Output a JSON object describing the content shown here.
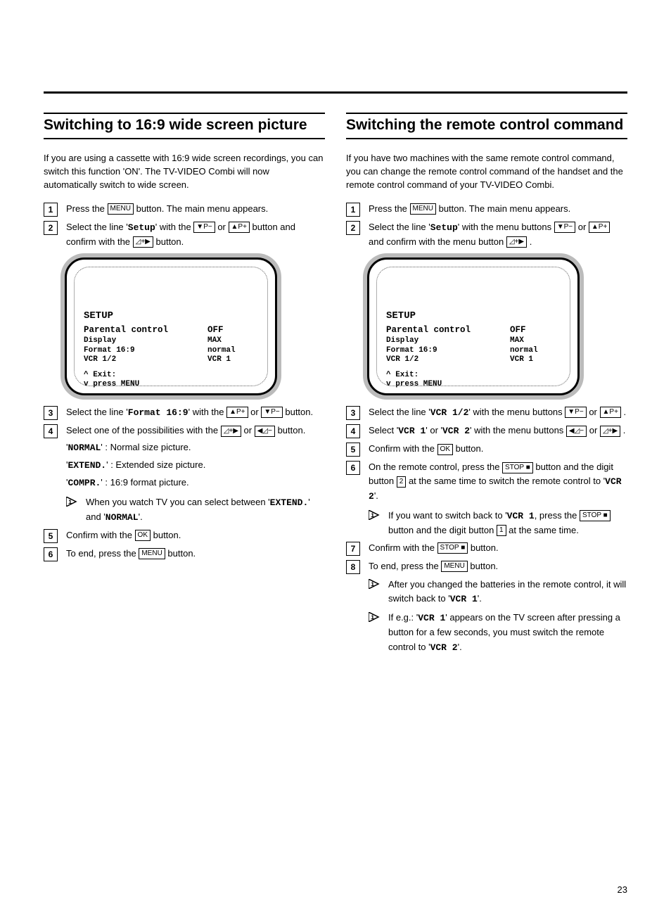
{
  "page_number": "23",
  "left": {
    "title": "Switching to 16:9 wide screen picture",
    "intro": "If you are using a cassette with 16:9 wide screen recordings, you can switch this function 'ON'. The TV-VIDEO Combi will now automatically switch to wide screen.",
    "steps": {
      "s1_a": "Press the ",
      "s1_btn": "MENU",
      "s1_b": " button. The main menu appears.",
      "s2_a": "Select the line '",
      "s2_code": "Setup",
      "s2_b": "' with the ",
      "s2_btn1": "▼P−",
      "s2_c": " or ",
      "s2_btn2": "▲P+",
      "s2_d": " button and confirm with the ",
      "s2_btn3": "◿+▶",
      "s2_e": " button.",
      "s3_a": "Select the line '",
      "s3_code": "Format 16:9",
      "s3_b": "' with the ",
      "s3_btn1": "▲P+",
      "s3_c": " or ",
      "s3_btn2": "▼P−",
      "s3_d": " button.",
      "s4_a": "Select one of the possibilities with the ",
      "s4_btn1": "◿+▶",
      "s4_b": " or ",
      "s4_btn2": "◀◿−",
      "s4_c": " button.",
      "s4_opt1_code": "NORMAL",
      "s4_opt1_txt": " : Normal size picture.",
      "s4_opt2_code": "EXTEND.",
      "s4_opt2_txt": " : Extended size picture.",
      "s4_opt3_code": "COMPR.",
      "s4_opt3_txt": " : 16:9 format picture.",
      "s4_note_a": "When you watch TV you can select between '",
      "s4_note_code1": "EXTEND.",
      "s4_note_b": "' and '",
      "s4_note_code2": "NORMAL",
      "s4_note_c": "'.",
      "s5_a": "Confirm with the ",
      "s5_btn": "OK",
      "s5_b": " button.",
      "s6_a": "To end, press the ",
      "s6_btn": "MENU",
      "s6_b": " button."
    },
    "osd": {
      "title": "SETUP",
      "r1_l": "Parental control",
      "r1_r": "OFF",
      "r2_l": "Display",
      "r2_r": "MAX",
      "r3_l": "Format 16:9",
      "r3_r": "normal",
      "r4_l": "VCR 1/2",
      "r4_r": "VCR 1",
      "f1": "^ Exit:",
      "f2": "v press MENU"
    }
  },
  "right": {
    "title": "Switching the remote control command",
    "intro": "If you have two machines with the same remote control command, you can change the remote control command of the handset and the remote control command of your TV-VIDEO Combi.",
    "steps": {
      "s1_a": "Press the ",
      "s1_btn": "MENU",
      "s1_b": " button. The main menu appears.",
      "s2_a": "Select the line '",
      "s2_code": "Setup",
      "s2_b": "' with the menu buttons ",
      "s2_btn1": "▼P−",
      "s2_c": " or ",
      "s2_btn2": "▲P+",
      "s2_d": " and confirm with the menu button ",
      "s2_btn3": "◿+▶",
      "s2_e": " .",
      "s3_a": "Select the line '",
      "s3_code": "VCR 1/2",
      "s3_b": "' with the menu buttons ",
      "s3_btn1": "▼P−",
      "s3_c": " or ",
      "s3_btn2": "▲P+",
      "s3_d": " .",
      "s4_a": "Select '",
      "s4_code1": "VCR 1",
      "s4_b": "' or '",
      "s4_code2": "VCR 2",
      "s4_c": "' with the menu buttons ",
      "s4_btn1": "◀◿−",
      "s4_d": " or ",
      "s4_btn2": "◿+▶",
      "s4_e": " .",
      "s5_a": "Confirm with the ",
      "s5_btn": "OK",
      "s5_b": " button.",
      "s6_a": "On the remote control, press the ",
      "s6_btn1": "STOP ■",
      "s6_b": " button and the digit button ",
      "s6_btn2": "2",
      "s6_c": " at the same time to switch the remote control to '",
      "s6_code": "VCR 2",
      "s6_d": "'.",
      "s6_note_a": "If you want to switch back to '",
      "s6_note_code": "VCR 1",
      "s6_note_b": ", press the ",
      "s6_note_btn1": "STOP ■",
      "s6_note_c": " button and the digit button ",
      "s6_note_btn2": "1",
      "s6_note_d": " at the same time.",
      "s7_a": "Confirm with the ",
      "s7_btn": "STOP ■",
      "s7_b": " button.",
      "s8_a": "To end, press the ",
      "s8_btn": "MENU",
      "s8_b": " button.",
      "s8_note1_a": "After you changed the batteries in the remote control, it will switch back to '",
      "s8_note1_code": "VCR 1",
      "s8_note1_b": "'.",
      "s8_note2_a": "If e.g.: '",
      "s8_note2_code1": "VCR 1",
      "s8_note2_b": "' appears on the TV screen after pressing a button for a few seconds, you must switch the remote control to '",
      "s8_note2_code2": "VCR 2",
      "s8_note2_c": "'."
    },
    "osd": {
      "title": "SETUP",
      "r1_l": "Parental control",
      "r1_r": "OFF",
      "r2_l": "Display",
      "r2_r": "MAX",
      "r3_l": "Format 16:9",
      "r3_r": "normal",
      "r4_l": "VCR 1/2",
      "r4_r": "VCR 1",
      "f1": "^ Exit:",
      "f2": "v press MENU"
    }
  }
}
